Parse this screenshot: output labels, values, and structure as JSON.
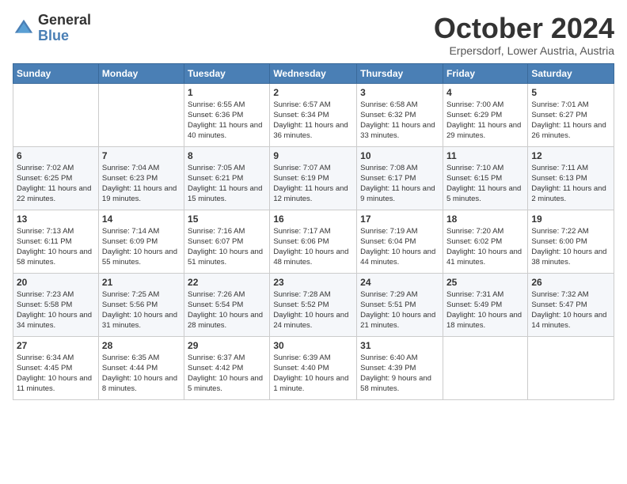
{
  "header": {
    "logo_general": "General",
    "logo_blue": "Blue",
    "title": "October 2024",
    "location": "Erpersdorf, Lower Austria, Austria"
  },
  "weekdays": [
    "Sunday",
    "Monday",
    "Tuesday",
    "Wednesday",
    "Thursday",
    "Friday",
    "Saturday"
  ],
  "weeks": [
    [
      {
        "day": "",
        "sunrise": "",
        "sunset": "",
        "daylight": ""
      },
      {
        "day": "",
        "sunrise": "",
        "sunset": "",
        "daylight": ""
      },
      {
        "day": "1",
        "sunrise": "Sunrise: 6:55 AM",
        "sunset": "Sunset: 6:36 PM",
        "daylight": "Daylight: 11 hours and 40 minutes."
      },
      {
        "day": "2",
        "sunrise": "Sunrise: 6:57 AM",
        "sunset": "Sunset: 6:34 PM",
        "daylight": "Daylight: 11 hours and 36 minutes."
      },
      {
        "day": "3",
        "sunrise": "Sunrise: 6:58 AM",
        "sunset": "Sunset: 6:32 PM",
        "daylight": "Daylight: 11 hours and 33 minutes."
      },
      {
        "day": "4",
        "sunrise": "Sunrise: 7:00 AM",
        "sunset": "Sunset: 6:29 PM",
        "daylight": "Daylight: 11 hours and 29 minutes."
      },
      {
        "day": "5",
        "sunrise": "Sunrise: 7:01 AM",
        "sunset": "Sunset: 6:27 PM",
        "daylight": "Daylight: 11 hours and 26 minutes."
      }
    ],
    [
      {
        "day": "6",
        "sunrise": "Sunrise: 7:02 AM",
        "sunset": "Sunset: 6:25 PM",
        "daylight": "Daylight: 11 hours and 22 minutes."
      },
      {
        "day": "7",
        "sunrise": "Sunrise: 7:04 AM",
        "sunset": "Sunset: 6:23 PM",
        "daylight": "Daylight: 11 hours and 19 minutes."
      },
      {
        "day": "8",
        "sunrise": "Sunrise: 7:05 AM",
        "sunset": "Sunset: 6:21 PM",
        "daylight": "Daylight: 11 hours and 15 minutes."
      },
      {
        "day": "9",
        "sunrise": "Sunrise: 7:07 AM",
        "sunset": "Sunset: 6:19 PM",
        "daylight": "Daylight: 11 hours and 12 minutes."
      },
      {
        "day": "10",
        "sunrise": "Sunrise: 7:08 AM",
        "sunset": "Sunset: 6:17 PM",
        "daylight": "Daylight: 11 hours and 9 minutes."
      },
      {
        "day": "11",
        "sunrise": "Sunrise: 7:10 AM",
        "sunset": "Sunset: 6:15 PM",
        "daylight": "Daylight: 11 hours and 5 minutes."
      },
      {
        "day": "12",
        "sunrise": "Sunrise: 7:11 AM",
        "sunset": "Sunset: 6:13 PM",
        "daylight": "Daylight: 11 hours and 2 minutes."
      }
    ],
    [
      {
        "day": "13",
        "sunrise": "Sunrise: 7:13 AM",
        "sunset": "Sunset: 6:11 PM",
        "daylight": "Daylight: 10 hours and 58 minutes."
      },
      {
        "day": "14",
        "sunrise": "Sunrise: 7:14 AM",
        "sunset": "Sunset: 6:09 PM",
        "daylight": "Daylight: 10 hours and 55 minutes."
      },
      {
        "day": "15",
        "sunrise": "Sunrise: 7:16 AM",
        "sunset": "Sunset: 6:07 PM",
        "daylight": "Daylight: 10 hours and 51 minutes."
      },
      {
        "day": "16",
        "sunrise": "Sunrise: 7:17 AM",
        "sunset": "Sunset: 6:06 PM",
        "daylight": "Daylight: 10 hours and 48 minutes."
      },
      {
        "day": "17",
        "sunrise": "Sunrise: 7:19 AM",
        "sunset": "Sunset: 6:04 PM",
        "daylight": "Daylight: 10 hours and 44 minutes."
      },
      {
        "day": "18",
        "sunrise": "Sunrise: 7:20 AM",
        "sunset": "Sunset: 6:02 PM",
        "daylight": "Daylight: 10 hours and 41 minutes."
      },
      {
        "day": "19",
        "sunrise": "Sunrise: 7:22 AM",
        "sunset": "Sunset: 6:00 PM",
        "daylight": "Daylight: 10 hours and 38 minutes."
      }
    ],
    [
      {
        "day": "20",
        "sunrise": "Sunrise: 7:23 AM",
        "sunset": "Sunset: 5:58 PM",
        "daylight": "Daylight: 10 hours and 34 minutes."
      },
      {
        "day": "21",
        "sunrise": "Sunrise: 7:25 AM",
        "sunset": "Sunset: 5:56 PM",
        "daylight": "Daylight: 10 hours and 31 minutes."
      },
      {
        "day": "22",
        "sunrise": "Sunrise: 7:26 AM",
        "sunset": "Sunset: 5:54 PM",
        "daylight": "Daylight: 10 hours and 28 minutes."
      },
      {
        "day": "23",
        "sunrise": "Sunrise: 7:28 AM",
        "sunset": "Sunset: 5:52 PM",
        "daylight": "Daylight: 10 hours and 24 minutes."
      },
      {
        "day": "24",
        "sunrise": "Sunrise: 7:29 AM",
        "sunset": "Sunset: 5:51 PM",
        "daylight": "Daylight: 10 hours and 21 minutes."
      },
      {
        "day": "25",
        "sunrise": "Sunrise: 7:31 AM",
        "sunset": "Sunset: 5:49 PM",
        "daylight": "Daylight: 10 hours and 18 minutes."
      },
      {
        "day": "26",
        "sunrise": "Sunrise: 7:32 AM",
        "sunset": "Sunset: 5:47 PM",
        "daylight": "Daylight: 10 hours and 14 minutes."
      }
    ],
    [
      {
        "day": "27",
        "sunrise": "Sunrise: 6:34 AM",
        "sunset": "Sunset: 4:45 PM",
        "daylight": "Daylight: 10 hours and 11 minutes."
      },
      {
        "day": "28",
        "sunrise": "Sunrise: 6:35 AM",
        "sunset": "Sunset: 4:44 PM",
        "daylight": "Daylight: 10 hours and 8 minutes."
      },
      {
        "day": "29",
        "sunrise": "Sunrise: 6:37 AM",
        "sunset": "Sunset: 4:42 PM",
        "daylight": "Daylight: 10 hours and 5 minutes."
      },
      {
        "day": "30",
        "sunrise": "Sunrise: 6:39 AM",
        "sunset": "Sunset: 4:40 PM",
        "daylight": "Daylight: 10 hours and 1 minute."
      },
      {
        "day": "31",
        "sunrise": "Sunrise: 6:40 AM",
        "sunset": "Sunset: 4:39 PM",
        "daylight": "Daylight: 9 hours and 58 minutes."
      },
      {
        "day": "",
        "sunrise": "",
        "sunset": "",
        "daylight": ""
      },
      {
        "day": "",
        "sunrise": "",
        "sunset": "",
        "daylight": ""
      }
    ]
  ]
}
